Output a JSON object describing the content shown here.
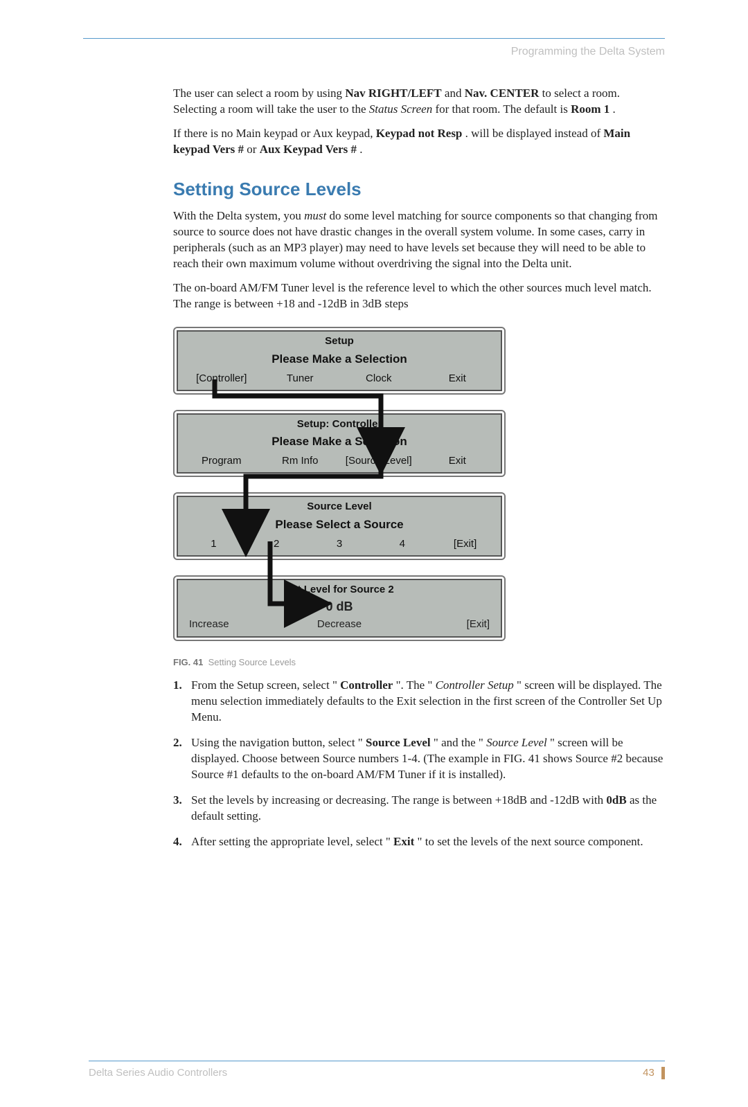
{
  "header": {
    "section": "Programming the Delta System"
  },
  "intro": {
    "p1_a": "The user can select a room by using ",
    "p1_b": "Nav RIGHT/LEFT",
    "p1_c": " and ",
    "p1_d": "Nav. CENTER",
    "p1_e": " to select a room. Selecting a room will take the user to the ",
    "p1_f": "Status Screen",
    "p1_g": " for that room. The default is ",
    "p1_h": "Room 1",
    "p1_i": ".",
    "p2_a": "If there is no Main keypad or Aux keypad, ",
    "p2_b": "Keypad not Resp",
    "p2_c": ". will be displayed instead of ",
    "p2_d": "Main keypad Vers #",
    "p2_e": " or ",
    "p2_f": "Aux Keypad Vers #",
    "p2_g": "."
  },
  "section_title": "Setting Source Levels",
  "body": {
    "p1_a": "With the Delta system, you ",
    "p1_b": "must",
    "p1_c": " do some level matching for source components so that changing from source to source does not have drastic changes in the overall system volume. In some cases, carry in peripherals (such as an MP3 player) may need to have levels set because they will need to be able to reach their own maximum volume without overdriving the signal into the Delta unit.",
    "p2": "The on-board AM/FM Tuner level is the reference level to which the other sources much level match. The range is between +18 and -12dB in 3dB steps"
  },
  "screens": [
    {
      "title": "Setup",
      "prompt": "Please Make a Selection",
      "row": [
        "[Controller]",
        "Tuner",
        "Clock",
        "Exit"
      ]
    },
    {
      "title": "Setup: Controller",
      "prompt": "Please Make a Selection",
      "row": [
        "Program",
        "Rm Info",
        "[Source Level]",
        "Exit"
      ]
    },
    {
      "title": "Source Level",
      "prompt": "Please Select a Source",
      "row": [
        "1",
        "2",
        "3",
        "4",
        "[Exit]"
      ]
    },
    {
      "title": "Set Level for Source 2",
      "value": "0 dB",
      "row3": [
        "Increase",
        "Decrease",
        "[Exit]"
      ]
    }
  ],
  "figure": {
    "label": "FIG. 41",
    "caption": "Setting Source Levels"
  },
  "steps": {
    "s1_a": "From the Setup screen, select \"",
    "s1_b": "Controller",
    "s1_c": "\". The \"",
    "s1_d": "Controller Setup",
    "s1_e": "\" screen will be displayed. The menu selection immediately defaults to the Exit selection in the first screen of the Controller Set Up Menu.",
    "s2_a": "Using the navigation button, select \"",
    "s2_b": "Source Level",
    "s2_c": "\" and the \"",
    "s2_d": "Source Level",
    "s2_e": "\" screen will be displayed. Choose between Source numbers 1-4. (The example in FIG. 41 shows Source #2 because Source #1 defaults to the on-board AM/FM Tuner if it is installed).",
    "s3_a": "Set the levels by increasing or decreasing. The range is between +18dB and -12dB with ",
    "s3_b": "0dB",
    "s3_c": " as the default setting.",
    "s4_a": "After setting the appropriate level, select \"",
    "s4_b": "Exit",
    "s4_c": "\" to set the levels of the next source component."
  },
  "footer": {
    "title": "Delta Series Audio Controllers",
    "page": "43"
  }
}
